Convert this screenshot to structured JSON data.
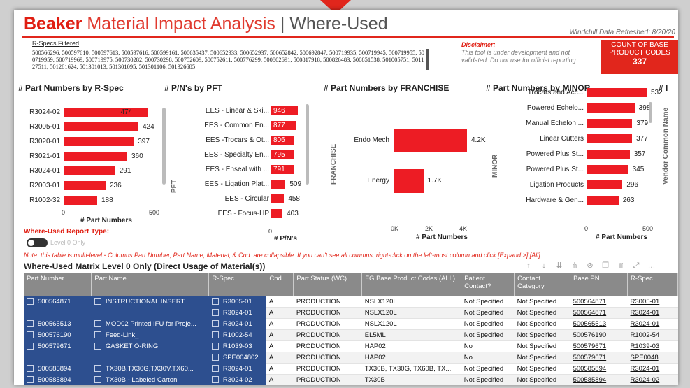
{
  "header": {
    "brand": "Beaker",
    "title_rest": "Material Impact Analysis",
    "title_sep": " | ",
    "title_sub": "Where-Used",
    "refreshed": "Windchill Data Refreshed: 8/20/20"
  },
  "rspecs": {
    "title": "R-Specs Filtered",
    "text": "500566296, 500597610, 500597613, 500597616, 500599161, 500635437, 500652933, 500652937, 500652842, 500692847, 500719935, 500719945, 500719955, 500719959, 500719969, 500719975, 500730282, 500730298, 500752609, 500752611, 500776299, 500802691, 500817918, 500826483, 500851538, 501005751, 501127511, 501281624, 501301013, 501301095, 501301106, 501326685"
  },
  "disclaimer": {
    "title": "Disclaimer:",
    "text": "This tool is under development and not validated. Do not use for official reporting."
  },
  "count_card": {
    "label": "COUNT OF BASE PRODUCT CODES",
    "value": "337"
  },
  "colors": {
    "accent": "#e1261c",
    "bar": "#ed1c24",
    "table_blue": "#2d4f8f"
  },
  "chart_data": [
    {
      "type": "bar",
      "title": "# Part Numbers by R-Spec",
      "categories": [
        "R3024-02",
        "R3005-01",
        "R3020-01",
        "R3021-01",
        "R3024-01",
        "R2003-01",
        "R1002-32"
      ],
      "values": [
        474,
        424,
        397,
        360,
        291,
        236,
        188
      ],
      "value_labels": [
        "474",
        "424",
        "397",
        "360",
        "291",
        "236",
        "188"
      ],
      "xlabel": "# Part Numbers",
      "xlim": [
        0,
        500
      ],
      "ticks": [
        "0",
        "500"
      ]
    },
    {
      "type": "bar",
      "title": "# P/N's by PFT",
      "categories": [
        "EES - Linear & Ski...",
        "EES - Common En...",
        "EES -Trocars & Ot...",
        "EES - Specialty En...",
        "EES - Enseal with ...",
        "EES - Ligation Plat...",
        "EES - Circular",
        "EES - Focus-HP"
      ],
      "values": [
        946,
        877,
        806,
        795,
        791,
        509,
        458,
        403
      ],
      "value_labels": [
        "946",
        "877",
        "806",
        "795",
        "791",
        "509",
        "458",
        "403"
      ],
      "xlabel": "# P/N's",
      "ylabel": "PFT",
      "xlim": [
        0,
        1000
      ],
      "ticks": [
        "0",
        "..."
      ]
    },
    {
      "type": "bar",
      "title": "# Part Numbers by FRANCHISE",
      "categories": [
        "Endo Mech",
        "Energy"
      ],
      "values": [
        4200,
        1700
      ],
      "value_labels": [
        "4.2K",
        "1.7K"
      ],
      "xlabel": "# Part Numbers",
      "ylabel": "FRANCHISE",
      "xlim": [
        0,
        5000
      ],
      "ticks": [
        "0K",
        "2K",
        "4K"
      ]
    },
    {
      "type": "bar",
      "title": "# Part Numbers by MINOR",
      "categories": [
        "Trocars and Acc...",
        "Powered Echelo...",
        "Manual Echelon ...",
        "Linear Cutters",
        "Powered Plus St...",
        "Powered Plus St...",
        "Ligation Products",
        "Hardware & Gen..."
      ],
      "values": [
        532,
        398,
        379,
        377,
        357,
        345,
        296,
        263
      ],
      "value_labels": [
        "532",
        "398",
        "379",
        "377",
        "357",
        "345",
        "296",
        "263"
      ],
      "xlabel": "# Part Numbers",
      "ylabel": "MINOR",
      "xlim": [
        0,
        500
      ],
      "ticks": [
        "0",
        "500"
      ]
    }
  ],
  "fifth_chart_title": "# I",
  "vendor_axis": "Vendor Common Name",
  "report": {
    "type_label": "Where-Used Report Type:",
    "toggle_label": "Level 0 Only",
    "note": "Note: this table is multi-level - Columns Part Number, Part Name, Material, & Cnd. are collapsible. If you can't see all columns, right-click on the left-most column and click [Expand >] [All]",
    "matrix_title": "Where-Used Matrix Level 0 Only (Direct Usage of Material(s))"
  },
  "table": {
    "headers": [
      "Part Number",
      "Part Name",
      "R-Spec",
      "Cnd.",
      "Part Status (WC)",
      "FG Base Product Codes (ALL)",
      "Patient Contact?",
      "Contact Category",
      "Base PN",
      "R-Spec"
    ],
    "rows": [
      [
        "500564871",
        "INSTRUCTIONAL INSERT",
        "R3005-01",
        "A",
        "PRODUCTION",
        "NSLX120L",
        "Not Specified",
        "Not Specified",
        "500564871",
        "R3005-01"
      ],
      [
        "",
        "",
        "R3024-01",
        "A",
        "PRODUCTION",
        "NSLX120L",
        "Not Specified",
        "Not Specified",
        "500564871",
        "R3024-01"
      ],
      [
        "500565513",
        "MOD02 Printed IFU for Proje...",
        "R3024-01",
        "A",
        "PRODUCTION",
        "NSLX120L",
        "Not Specified",
        "Not Specified",
        "500565513",
        "R3024-01"
      ],
      [
        "500576190",
        "Feed-Link_",
        "R1002-54",
        "A",
        "PRODUCTION",
        "EL5ML",
        "Not Specified",
        "Not Specified",
        "500576190",
        "R1002-54"
      ],
      [
        "500579671",
        "GASKET O-RING",
        "R1039-03",
        "A",
        "PRODUCTION",
        "HAP02",
        "No",
        "Not Specified",
        "500579671",
        "R1039-03"
      ],
      [
        "",
        "",
        "SPE004802",
        "A",
        "PRODUCTION",
        "HAP02",
        "No",
        "Not Specified",
        "500579671",
        "SPE0048"
      ],
      [
        "500585894",
        "TX30B,TX30G,TX30V,TX60...",
        "R3024-01",
        "A",
        "PRODUCTION",
        "TX30B, TX30G, TX60B, TX...",
        "Not Specified",
        "Not Specified",
        "500585894",
        "R3024-01"
      ],
      [
        "500585894",
        "TX30B - Labeled Carton",
        "R3024-02",
        "A",
        "PRODUCTION",
        "TX30B",
        "Not Specified",
        "Not Specified",
        "500585894",
        "R3024-02"
      ]
    ]
  }
}
